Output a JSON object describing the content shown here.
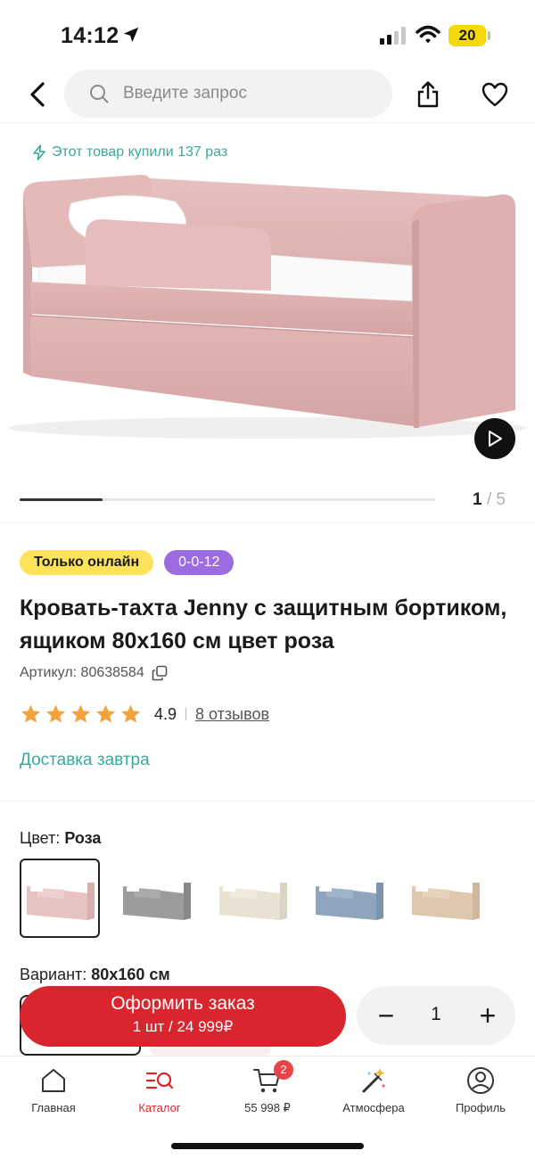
{
  "status_bar": {
    "time": "14:12",
    "battery": "20"
  },
  "header": {
    "search": {
      "placeholder": "Введите запрос"
    }
  },
  "gallery": {
    "bought_note": "Этот товар купили 137 раз",
    "current": "1",
    "separator": "/",
    "total": "5",
    "progress": 0.2
  },
  "badges": {
    "online": "Только онлайн",
    "credit": "0-0-12"
  },
  "product": {
    "title": "Кровать-тахта Jenny с защитным бортиком, ящиком 80х160 см цвет роза",
    "sku": "Артикул: 80638584",
    "rating": "4.9",
    "stars": 5,
    "reviews": "8 отзывов",
    "delivery": "Доставка завтра"
  },
  "color": {
    "label": "Цвет:",
    "value": "Роза",
    "swatches": [
      {
        "name": "rose",
        "fill": "#e8c4c2",
        "selected": true
      },
      {
        "name": "grey",
        "fill": "#9a9a9a",
        "selected": false
      },
      {
        "name": "cream",
        "fill": "#e8e1d2",
        "selected": false
      },
      {
        "name": "blue",
        "fill": "#8ea4bd",
        "selected": false
      },
      {
        "name": "beige",
        "fill": "#ddc7ad",
        "selected": false
      }
    ]
  },
  "variant": {
    "label": "Вариант:",
    "value": "80х160 см"
  },
  "order": {
    "button_label": "Оформить заказ",
    "button_sub": "1 шт / 24 999₽",
    "quantity": "1",
    "minus": "−",
    "plus": "+"
  },
  "bottom_nav": {
    "home": "Главная",
    "catalog": "Каталог",
    "cart": "55 998 ₽",
    "cart_count": "2",
    "atmosphere": "Атмосфера",
    "profile": "Профиль"
  },
  "colors": {
    "accent_red": "#d9262e",
    "teal": "#3aa89a",
    "star": "#f2a33a",
    "badge_yellow": "#fde35a",
    "badge_purple": "#9b6be0",
    "product_pink": "#e6bdbd"
  }
}
